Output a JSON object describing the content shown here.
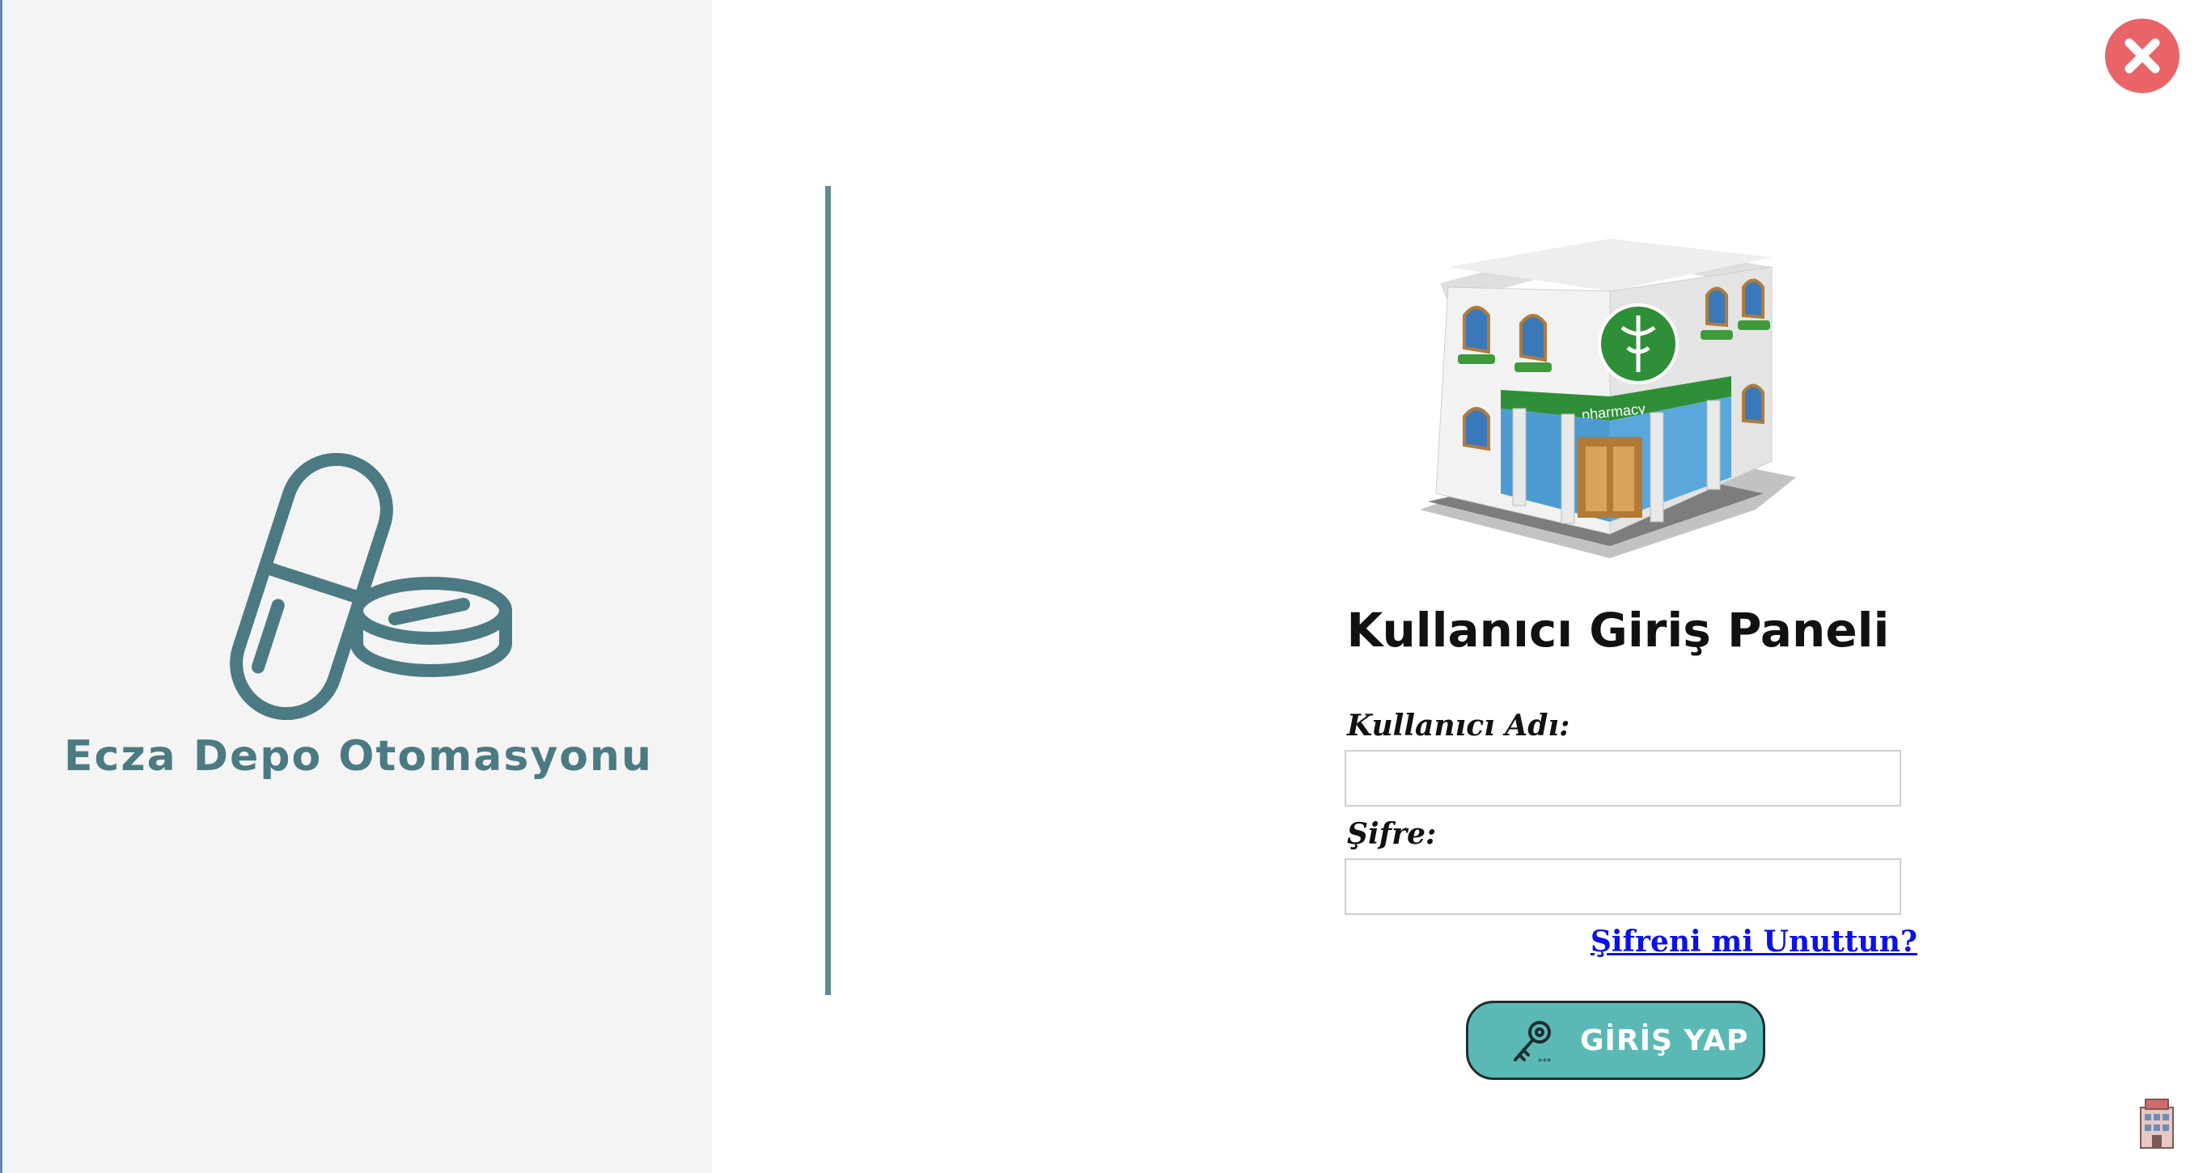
{
  "brand": {
    "title": "Ecza Depo Otomasyonu",
    "icon": "pills-icon",
    "color": "#4c7a82"
  },
  "window": {
    "close_icon": "close-icon",
    "close_color": "#e86467"
  },
  "login": {
    "image": "pharmacy-building-image",
    "title": "Kullanıcı Giriş Paneli",
    "username_label": "Kullanıcı Adı:",
    "username_value": "",
    "password_label": "Şifre:",
    "password_value": "",
    "forgot_link": "Şifreni mi Unuttun?",
    "submit_label": "GİRİŞ YAP",
    "submit_icon": "key-icon",
    "accent_color": "#5bb9b5"
  },
  "footer": {
    "icon": "building-icon"
  }
}
